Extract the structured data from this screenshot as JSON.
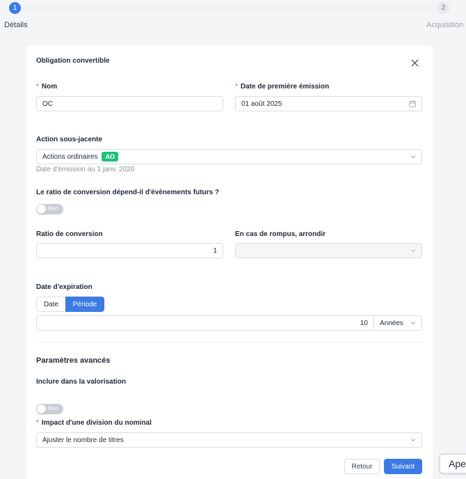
{
  "stepper": {
    "steps": [
      {
        "number": "1",
        "label": "Détails",
        "state": "active"
      },
      {
        "number": "2",
        "label": "Acquisition",
        "state": "inactive"
      }
    ]
  },
  "form": {
    "title": "Obligation convertible",
    "nom": {
      "label": "Nom",
      "value": "OC",
      "required": true
    },
    "date_emission": {
      "label": "Date de première émission",
      "value": "01 août 2025",
      "icon": "calendar-icon",
      "required": true
    },
    "action": {
      "label": "Action sous-jacente",
      "value": "Actions ordinaires",
      "tag": "AO",
      "hint": "Date d'émission au 1 janv. 2020"
    },
    "ratio_futurs": {
      "label": "Le ratio de conversion dépend-il d'évènements futurs ?",
      "toggle_label": "Non",
      "on": false
    },
    "ratio": {
      "label": "Ratio de conversion",
      "value": "1"
    },
    "arrondir": {
      "label": "En cas de rompus, arrondir",
      "value": ""
    },
    "expiration": {
      "label": "Date d'expiration",
      "segments": [
        {
          "label": "Date",
          "selected": false
        },
        {
          "label": "Période",
          "selected": true
        }
      ],
      "value": "10",
      "unit": "Années"
    },
    "advanced": {
      "title": "Paramètres avancés",
      "valorisation": {
        "label": "Inclure dans la valorisation",
        "toggle_label": "Non",
        "on": false
      },
      "impact": {
        "label": "Impact d'une division du nominal",
        "value": "Ajuster le nombre de titres",
        "required": true
      }
    },
    "buttons": {
      "back": "Retour",
      "next": "Suivant"
    }
  },
  "colors": {
    "primary": "#3b7be3",
    "tag": "#22c07a",
    "required": "#e5484d"
  },
  "overlay": {
    "text": "Ape"
  }
}
